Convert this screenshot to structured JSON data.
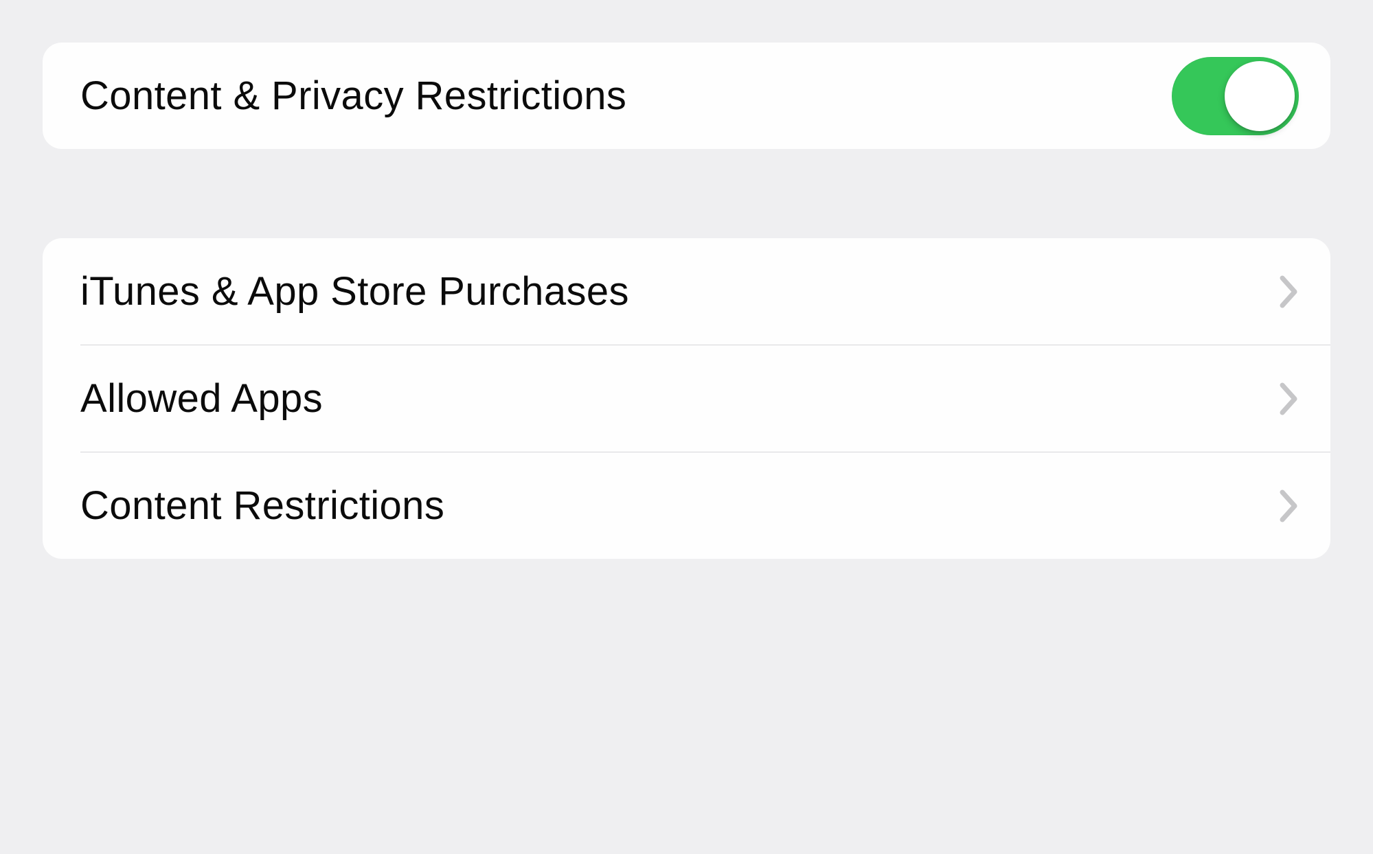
{
  "toggle_row": {
    "label": "Content & Privacy Restrictions",
    "enabled": true
  },
  "rows": [
    {
      "label": "iTunes & App Store Purchases"
    },
    {
      "label": "Allowed Apps"
    },
    {
      "label": "Content Restrictions"
    }
  ],
  "colors": {
    "toggle_on": "#35c759",
    "chevron": "#c6c6c8"
  }
}
